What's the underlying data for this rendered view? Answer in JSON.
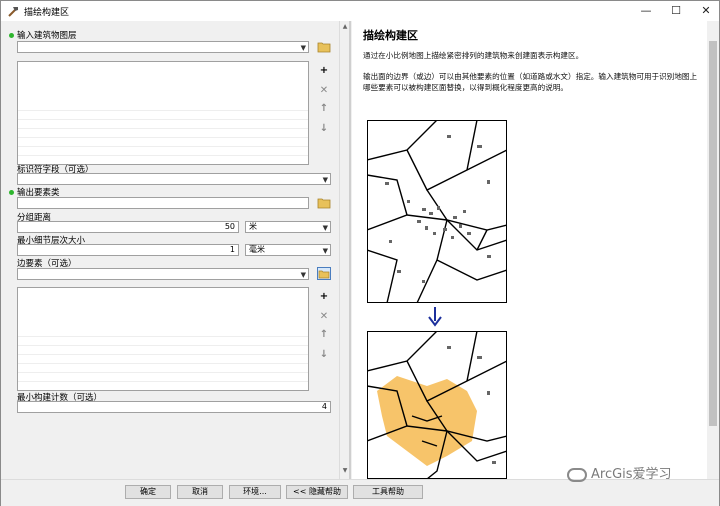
{
  "window": {
    "title": "描绘构建区"
  },
  "form": {
    "input_layer": {
      "label": "输入建筑物图层",
      "value": ""
    },
    "id_field": {
      "label": "标识符字段（可选）",
      "value": ""
    },
    "output_class": {
      "label": "输出要素类",
      "value": ""
    },
    "group_distance": {
      "label": "分组距离",
      "value": "50",
      "unit": "米"
    },
    "min_detail": {
      "label": "最小细节层次大小",
      "value": "1",
      "unit": "毫米"
    },
    "edge_features": {
      "label": "边要素（可选）",
      "value": ""
    },
    "min_building_count": {
      "label": "最小构建计数（可选）",
      "value": "4"
    }
  },
  "buttons": {
    "ok": "确定",
    "cancel": "取消",
    "env": "环境...",
    "hide_help": "<< 隐藏帮助",
    "tool_help": "工具帮助"
  },
  "help": {
    "title": "描绘构建区",
    "para1": "通过在小比例地图上描绘紧密排列的建筑物来创建面表示构建区。",
    "para2": "输出面的边界（或边）可以由其他要素的位置（如道路或水文）指定。输入建筑物可用于识别地图上哪些要素可以被构建区面替换，以得到概化程度更高的说明。"
  },
  "watermark": "ArcGis爱学习",
  "icons": [
    "hammer-icon",
    "minimize-icon",
    "maximize-icon",
    "close-icon",
    "folder-icon",
    "add-icon",
    "remove-icon",
    "up-arrow-icon",
    "down-arrow-icon",
    "down-arrow-result-icon"
  ],
  "colors": {
    "buildup": "#f7c46a",
    "required_dot": "#2db52d",
    "arrow": "#1c2f9c"
  }
}
